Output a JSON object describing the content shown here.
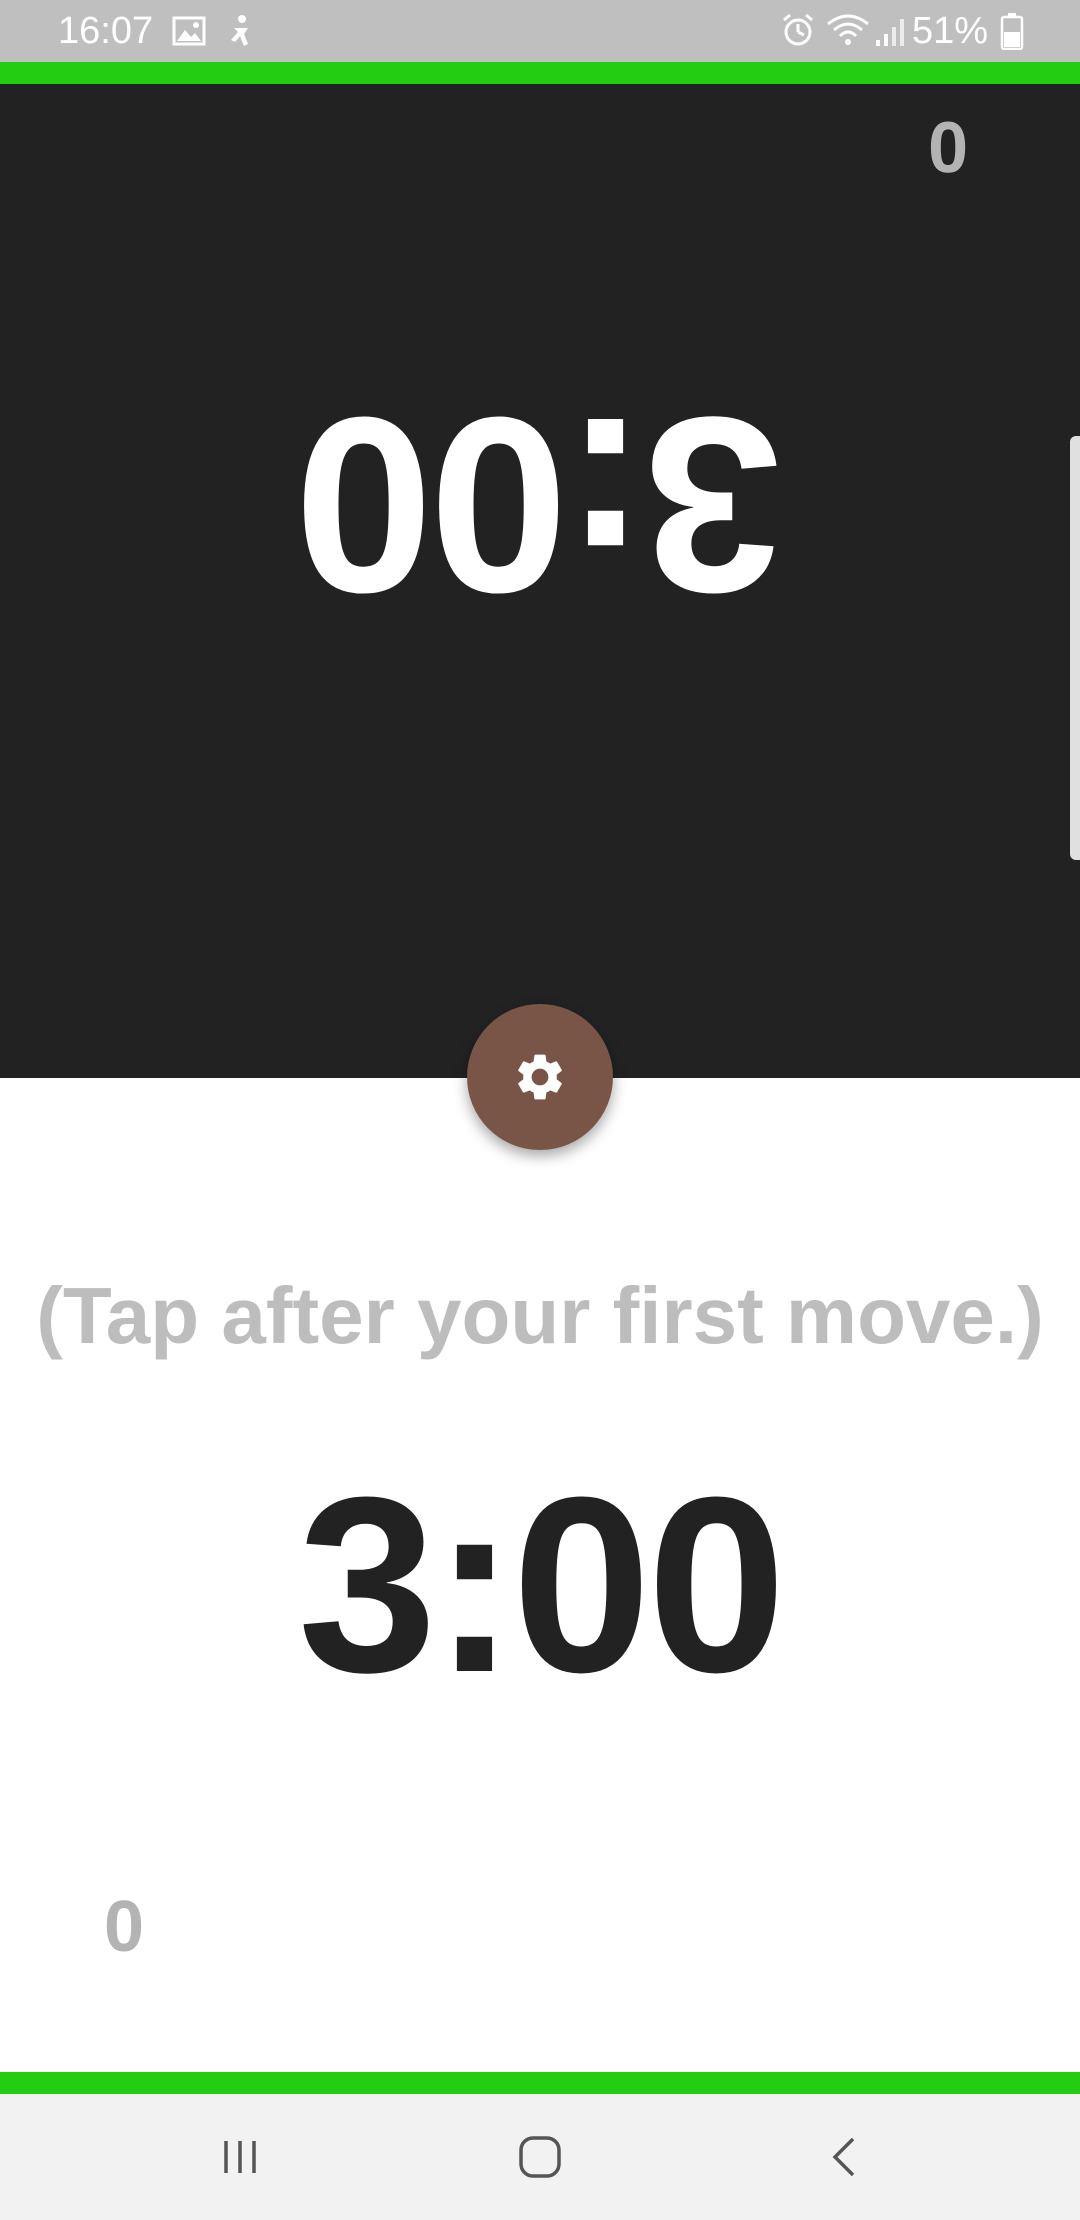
{
  "status_bar": {
    "time": "16:07",
    "battery_percent": "51%",
    "icons": [
      "gallery-icon",
      "accessibility-icon",
      "alarm-icon",
      "wifi-icon",
      "signal-icon",
      "battery-icon"
    ]
  },
  "opponent": {
    "moves": "0",
    "time": "3:00",
    "orientation": "upside-down"
  },
  "player": {
    "hint": "(Tap after your first move.)",
    "time": "3:00",
    "moves": "0"
  },
  "settings_button": {
    "icon": "gear-icon"
  },
  "nav_bar": {
    "icons": [
      "recent-apps-icon",
      "home-icon",
      "back-icon"
    ]
  },
  "colors": {
    "accent_green": "#22cc11",
    "opponent_panel": "#222222",
    "fab": "#795548",
    "muted_text": "#bdbdbd"
  }
}
